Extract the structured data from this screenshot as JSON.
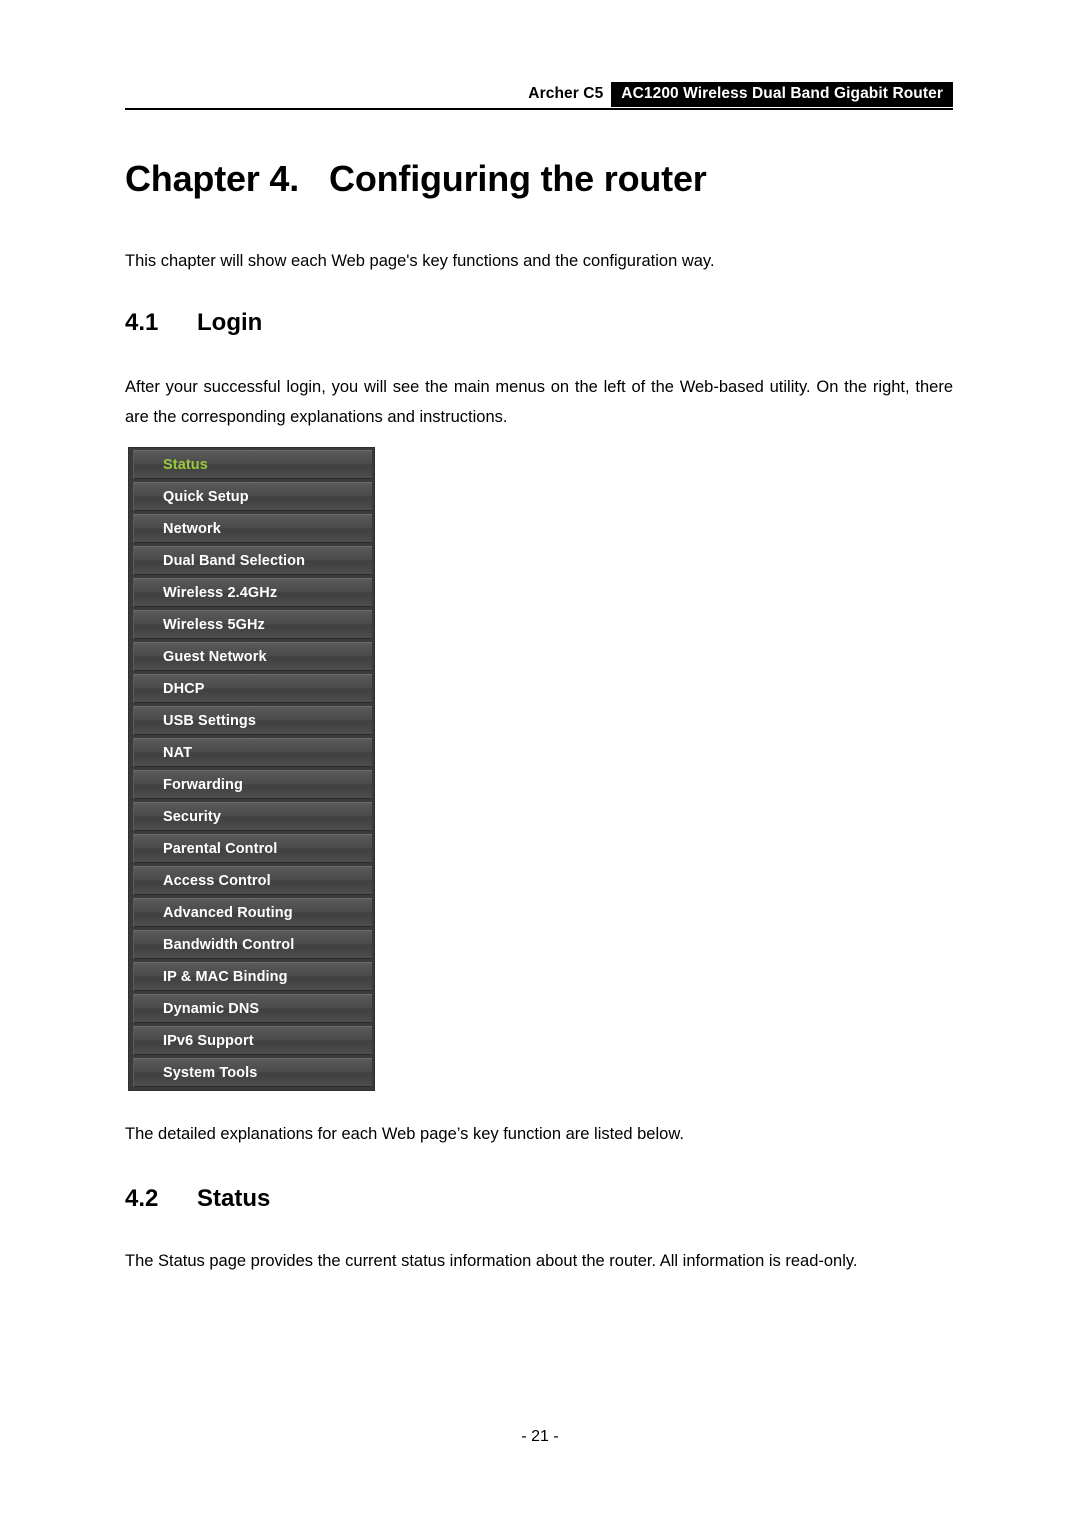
{
  "header": {
    "model": "Archer C5",
    "product": "AC1200 Wireless Dual Band Gigabit Router"
  },
  "chapter": {
    "number": "Chapter 4.",
    "title": "Configuring the router"
  },
  "paragraphs": {
    "intro": "This chapter will show each Web page's key functions and the configuration way.",
    "login": "After your successful login, you will see the main menus on the left of the Web-based utility. On the right, there are the corresponding explanations and instructions.",
    "below_menu": "The detailed explanations for each Web page’s key function are listed below.",
    "status": "The Status page provides the current status information about the router. All information is read-only."
  },
  "sections": [
    {
      "number": "4.1",
      "title": "Login"
    },
    {
      "number": "4.2",
      "title": "Status"
    }
  ],
  "menu": {
    "active_color": "#9ac93b",
    "items": [
      {
        "label": "Status",
        "active": true
      },
      {
        "label": "Quick Setup",
        "active": false
      },
      {
        "label": "Network",
        "active": false
      },
      {
        "label": "Dual Band Selection",
        "active": false
      },
      {
        "label": "Wireless 2.4GHz",
        "active": false
      },
      {
        "label": "Wireless 5GHz",
        "active": false
      },
      {
        "label": "Guest Network",
        "active": false
      },
      {
        "label": "DHCP",
        "active": false
      },
      {
        "label": "USB Settings",
        "active": false
      },
      {
        "label": "NAT",
        "active": false
      },
      {
        "label": "Forwarding",
        "active": false
      },
      {
        "label": "Security",
        "active": false
      },
      {
        "label": "Parental Control",
        "active": false
      },
      {
        "label": "Access Control",
        "active": false
      },
      {
        "label": "Advanced Routing",
        "active": false
      },
      {
        "label": "Bandwidth Control",
        "active": false
      },
      {
        "label": "IP & MAC Binding",
        "active": false
      },
      {
        "label": "Dynamic DNS",
        "active": false
      },
      {
        "label": "IPv6 Support",
        "active": false
      },
      {
        "label": "System Tools",
        "active": false
      }
    ]
  },
  "footer": {
    "page_number": "- 21 -"
  }
}
